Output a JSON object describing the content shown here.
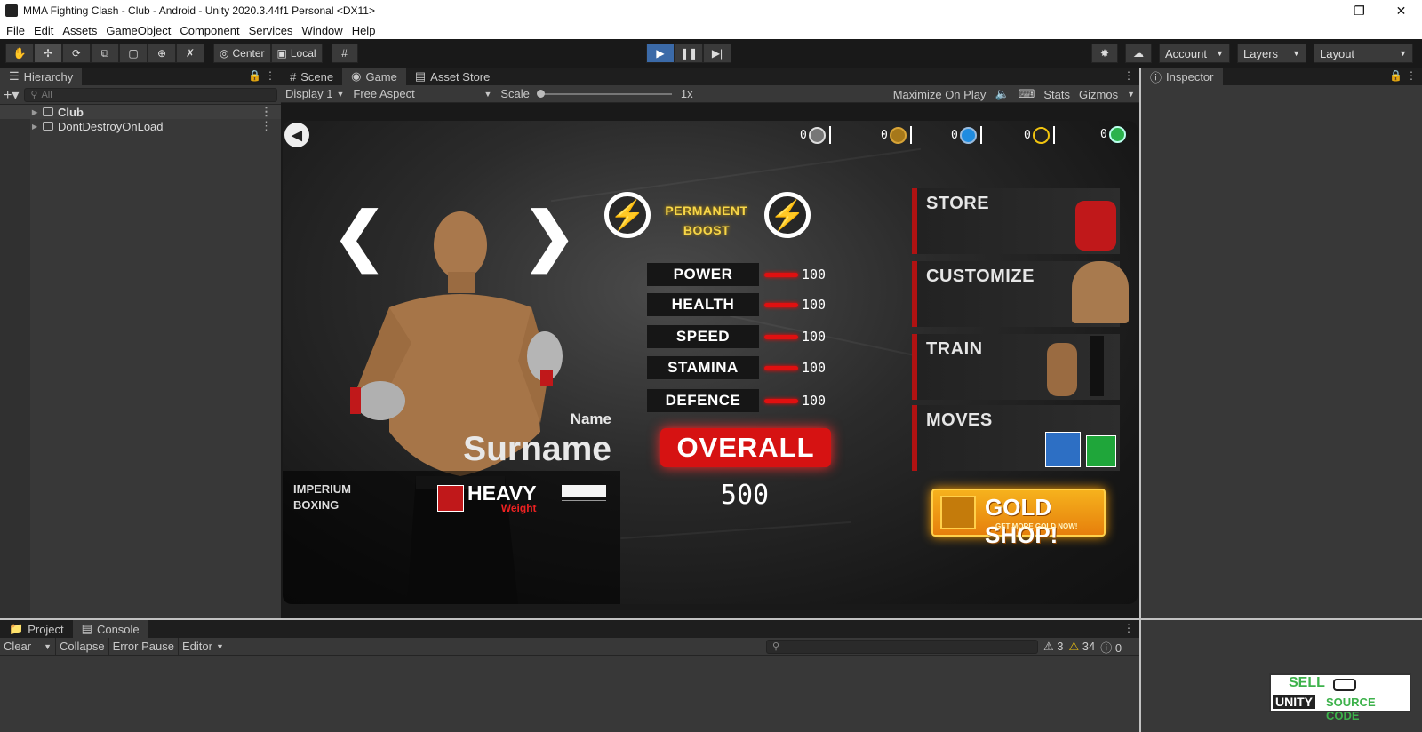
{
  "window": {
    "title": "MMA Fighting Clash - Club - Android - Unity 2020.3.44f1 Personal <DX11>"
  },
  "menu": [
    "File",
    "Edit",
    "Assets",
    "GameObject",
    "Component",
    "Services",
    "Window",
    "Help"
  ],
  "toolbar": {
    "pivot_center": "Center",
    "pivot_local": "Local",
    "account": "Account",
    "layers": "Layers",
    "layout": "Layout"
  },
  "hierarchy": {
    "tab": "Hierarchy",
    "search_placeholder": "All",
    "items": [
      "Club",
      "DontDestroyOnLoad"
    ]
  },
  "center_tabs": [
    "Scene",
    "Game",
    "Asset Store"
  ],
  "gamebar": {
    "display": "Display 1",
    "aspect": "Free Aspect",
    "scale_label": "Scale",
    "scale_value": "1x",
    "maximize": "Maximize On Play",
    "stats": "Stats",
    "gizmos": "Gizmos"
  },
  "inspector": {
    "tab": "Inspector"
  },
  "bottom": {
    "tabs": [
      "Project",
      "Console"
    ],
    "clear": "Clear",
    "collapse": "Collapse",
    "error_pause": "Error Pause",
    "editor": "Editor",
    "count_errors": "3",
    "count_warnings": "34",
    "count_info": "0"
  },
  "game": {
    "currencies": [
      "0",
      "0",
      "0",
      "0",
      "0"
    ],
    "boost": {
      "line1": "PERMANENT",
      "line2": "BOOST"
    },
    "stats": [
      {
        "label": "POWER",
        "value": "100"
      },
      {
        "label": "HEALTH",
        "value": "100"
      },
      {
        "label": "SPEED",
        "value": "100"
      },
      {
        "label": "STAMINA",
        "value": "100"
      },
      {
        "label": "DEFENCE",
        "value": "100"
      }
    ],
    "overall_label": "OVERALL",
    "overall_value": "500",
    "name": "Name",
    "surname": "Surname",
    "club_line1": "IMPERIUM",
    "club_line2": "BOXING",
    "weight_main": "HEAVY",
    "weight_sub": "Weight",
    "menu": [
      "STORE",
      "CUSTOMIZE",
      "TRAIN",
      "MOVES"
    ],
    "goldshop_title": "GOLD SHOP!",
    "goldshop_sub": "GET MORE GOLD NOW!"
  },
  "watermark": {
    "line1": "SELL",
    "line2": "UNITY",
    "line3": "SOURCE CODE"
  },
  "colors": {
    "accent_red": "#d61212",
    "play_blue": "#3b6aa8",
    "gold": "#f6b21d"
  }
}
